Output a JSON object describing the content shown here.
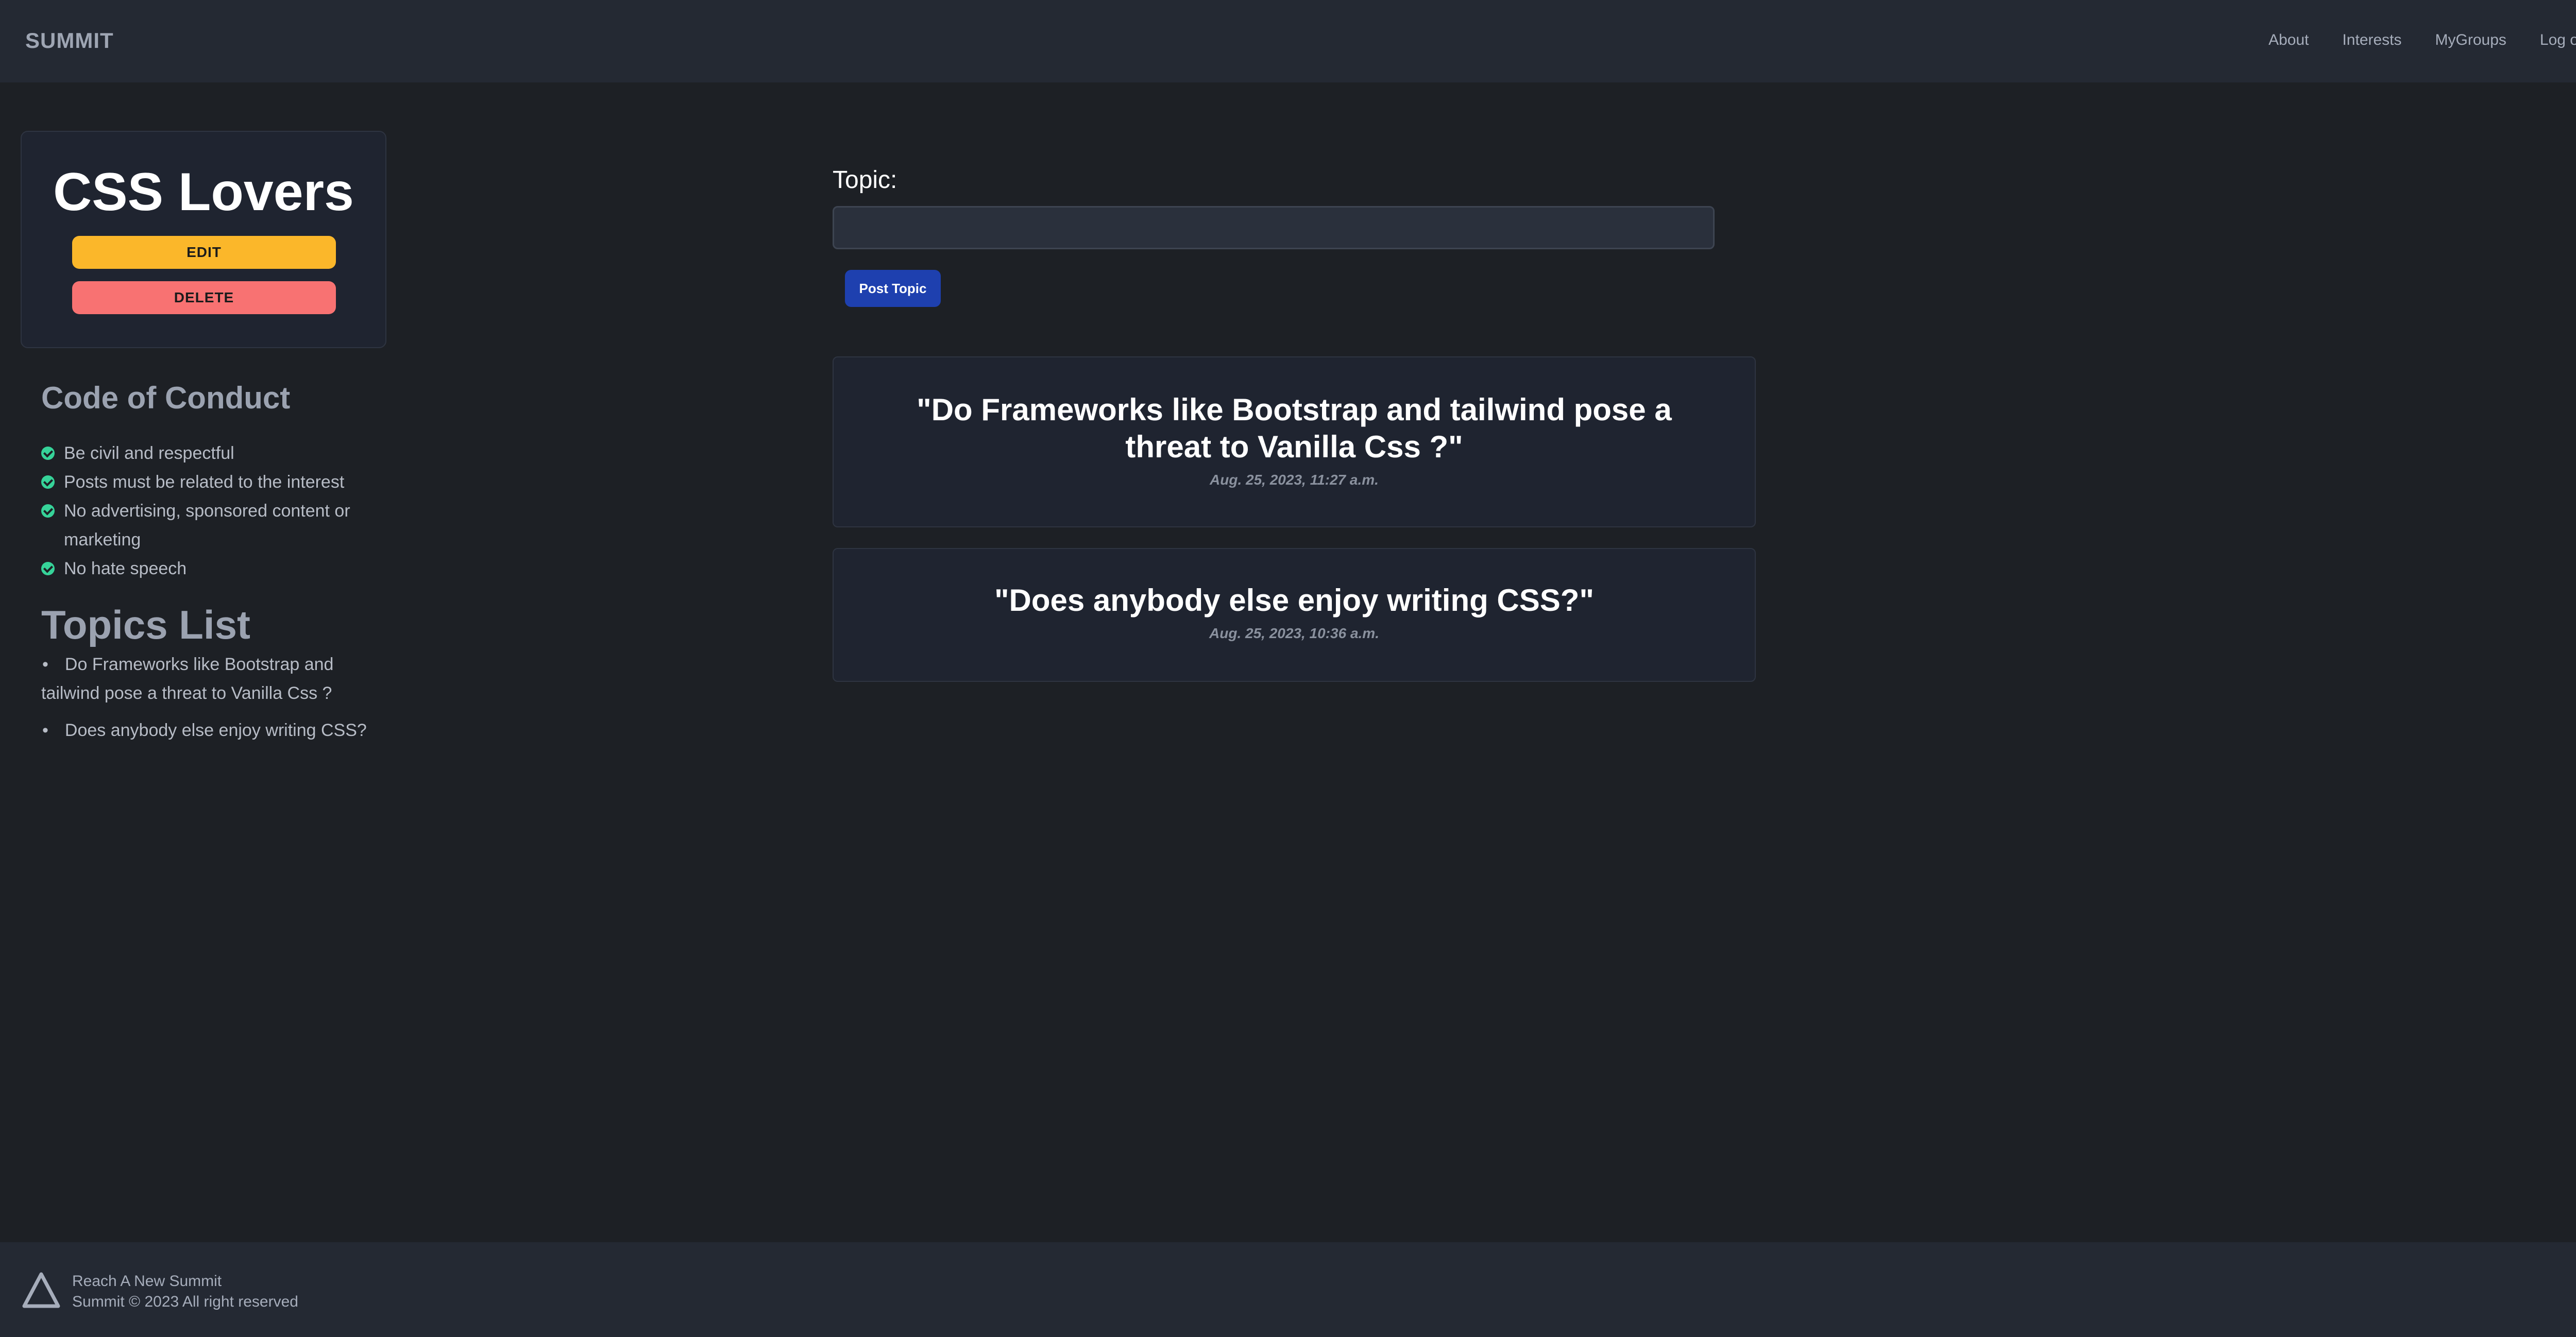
{
  "navbar": {
    "brand": "SUMMIT",
    "links": [
      "About",
      "Interests",
      "MyGroups",
      "Log out"
    ]
  },
  "group": {
    "title": "CSS Lovers",
    "edit_label": "EDIT",
    "delete_label": "DELETE"
  },
  "code_of_conduct": {
    "title": "Code of Conduct",
    "rules": [
      "Be civil and respectful",
      "Posts must be related to the interest",
      "No advertising, sponsored content or marketing",
      "No hate speech"
    ]
  },
  "topics_list": {
    "title": "Topics List",
    "items": [
      "Do Frameworks like Bootstrap and tailwind pose a threat to Vanilla Css ?",
      "Does anybody else enjoy writing CSS?"
    ]
  },
  "form": {
    "label": "Topic:",
    "input_value": "",
    "input_placeholder": "",
    "submit_label": "Post Topic"
  },
  "topics": [
    {
      "title": "\"Do Frameworks like Bootstrap and tailwind pose a threat to Vanilla Css ?\"",
      "date": "Aug. 25, 2023, 11:27 a.m."
    },
    {
      "title": "\"Does anybody else enjoy writing CSS?\"",
      "date": "Aug. 25, 2023, 10:36 a.m."
    }
  ],
  "footer": {
    "logo_icon": "triangle-logo-icon",
    "line1": "Reach A New Summit",
    "line2": "Summit © 2023 All right reserved"
  },
  "colors": {
    "background": "#1d2025",
    "navbar": "#242933",
    "card": "#1f2430",
    "edit_button": "#fbb72a",
    "delete_button": "#f87272",
    "primary_button": "#1e40af",
    "check_icon": "#36d399"
  }
}
